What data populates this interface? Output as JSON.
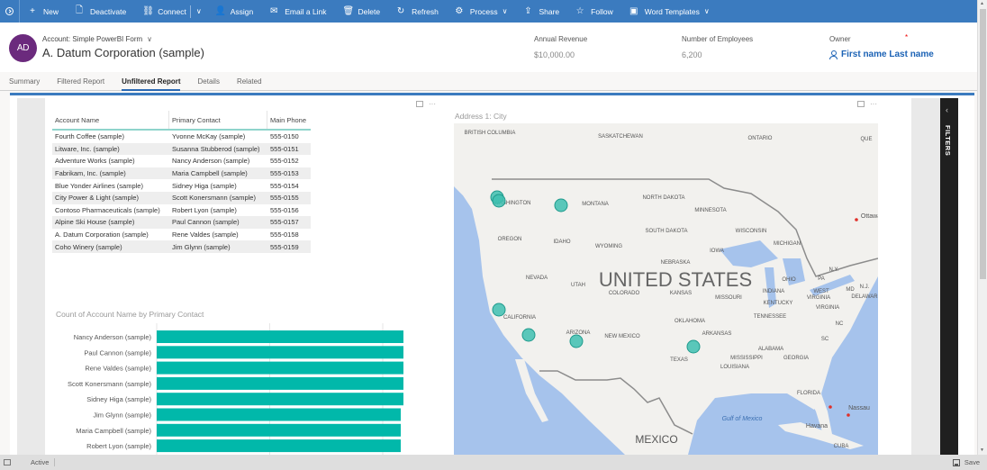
{
  "commandbar": {
    "items": [
      {
        "label": "New",
        "icon": "+"
      },
      {
        "label": "Deactivate",
        "icon": "🗋"
      },
      {
        "label": "Connect",
        "icon": "⛓"
      },
      {
        "label": "Assign",
        "icon": "👤"
      },
      {
        "label": "Email a Link",
        "icon": "✉"
      },
      {
        "label": "Delete",
        "icon": "🗑"
      },
      {
        "label": "Refresh",
        "icon": "↻"
      },
      {
        "label": "Process",
        "icon": "⚙"
      },
      {
        "label": "Share",
        "icon": "⇪"
      },
      {
        "label": "Follow",
        "icon": "☆"
      },
      {
        "label": "Word Templates",
        "icon": "▣"
      }
    ],
    "chevron": "∨"
  },
  "header": {
    "avatar_initials": "AD",
    "form_selector": "Account: Simple PowerBI Form",
    "record_title": "A. Datum Corporation (sample)",
    "fields": [
      {
        "label": "Annual Revenue",
        "value": "$10,000.00"
      },
      {
        "label": "Number of Employees",
        "value": "6,200"
      },
      {
        "label": "Owner",
        "value": "First name Last name",
        "required_mark": "*"
      }
    ]
  },
  "tabs": [
    {
      "label": "Summary",
      "active": false
    },
    {
      "label": "Filtered Report",
      "active": false
    },
    {
      "label": "Unfiltered Report",
      "active": true
    },
    {
      "label": "Details",
      "active": false
    },
    {
      "label": "Related",
      "active": false
    }
  ],
  "report": {
    "more_options": "···",
    "filters_label": "FILTERS",
    "filters_chevron": "‹",
    "table": {
      "columns": [
        "Account Name",
        "Primary Contact",
        "Main Phone"
      ],
      "rows": [
        [
          "Fourth Coffee (sample)",
          "Yvonne McKay (sample)",
          "555-0150"
        ],
        [
          "Litware, Inc. (sample)",
          "Susanna Stubberod (sample)",
          "555-0151"
        ],
        [
          "Adventure Works (sample)",
          "Nancy Anderson (sample)",
          "555-0152"
        ],
        [
          "Fabrikam, Inc. (sample)",
          "Maria Campbell (sample)",
          "555-0153"
        ],
        [
          "Blue Yonder Airlines (sample)",
          "Sidney Higa (sample)",
          "555-0154"
        ],
        [
          "City Power & Light (sample)",
          "Scott Konersmann (sample)",
          "555-0155"
        ],
        [
          "Contoso Pharmaceuticals (sample)",
          "Robert Lyon (sample)",
          "555-0156"
        ],
        [
          "Alpine Ski House (sample)",
          "Paul Cannon (sample)",
          "555-0157"
        ],
        [
          "A. Datum Corporation (sample)",
          "Rene Valdes (sample)",
          "555-0158"
        ],
        [
          "Coho Winery (sample)",
          "Jim Glynn (sample)",
          "555-0159"
        ]
      ]
    },
    "map": {
      "title": "Address 1: City",
      "labels": {
        "country": "UNITED STATES",
        "canada": [
          "BRITISH COLUMBIA",
          "SASKATCHEWAN",
          "ONTARIO",
          "QUE"
        ],
        "states": [
          "WASHINGTON",
          "MONTANA",
          "NORTH DAKOTA",
          "MINNESOTA",
          "WISCONSIN",
          "MICHIGAN",
          "OREGON",
          "IDAHO",
          "WYOMING",
          "SOUTH DAKOTA",
          "IOWA",
          "NEBRASKA",
          "NEVADA",
          "UTAH",
          "COLORADO",
          "KANSAS",
          "MISSOURI",
          "OHIO",
          "PA",
          "N.Y.",
          "INDIANA",
          "WEST VIRGINIA",
          "DELAWARE",
          "MD",
          "N.J.",
          "KENTUCKY",
          "VIRGINIA",
          "CALIFORNIA",
          "ARIZONA",
          "NEW MEXICO",
          "OKLAHOMA",
          "TENNESSEE",
          "NC",
          "SC",
          "ARKANSAS",
          "TEXAS",
          "ALABAMA",
          "MISSISSIPPI",
          "GEORGIA",
          "LOUISIANA",
          "FLORIDA"
        ],
        "cities": [
          "Ottawa",
          "Havana",
          "Nassau"
        ],
        "other": [
          "Gulf of Mexico",
          "MEXICO",
          "CUBA"
        ]
      },
      "points": [
        {
          "name": "Seattle area 1"
        },
        {
          "name": "Seattle area 2"
        },
        {
          "name": "Montana/Idaho"
        },
        {
          "name": "Northern California"
        },
        {
          "name": "Southern California"
        },
        {
          "name": "Arizona"
        },
        {
          "name": "Texas"
        }
      ]
    }
  },
  "chart_data": {
    "type": "bar",
    "orientation": "horizontal",
    "title": "Count of Account Name by Primary Contact",
    "categories": [
      "Nancy Anderson (sample)",
      "Paul Cannon (sample)",
      "Rene Valdes (sample)",
      "Scott Konersmann (sample)",
      "Sidney Higa (sample)",
      "Jim Glynn (sample)",
      "Maria Campbell (sample)",
      "Robert Lyon (sample)"
    ],
    "values": [
      1,
      1,
      1,
      1,
      1,
      1,
      1,
      1
    ],
    "xlim": [
      0,
      1
    ],
    "gridlines": true,
    "color": "#01b8aa",
    "xlabel": "",
    "ylabel": ""
  },
  "statusbar": {
    "status": "Active",
    "save_label": "Save"
  }
}
